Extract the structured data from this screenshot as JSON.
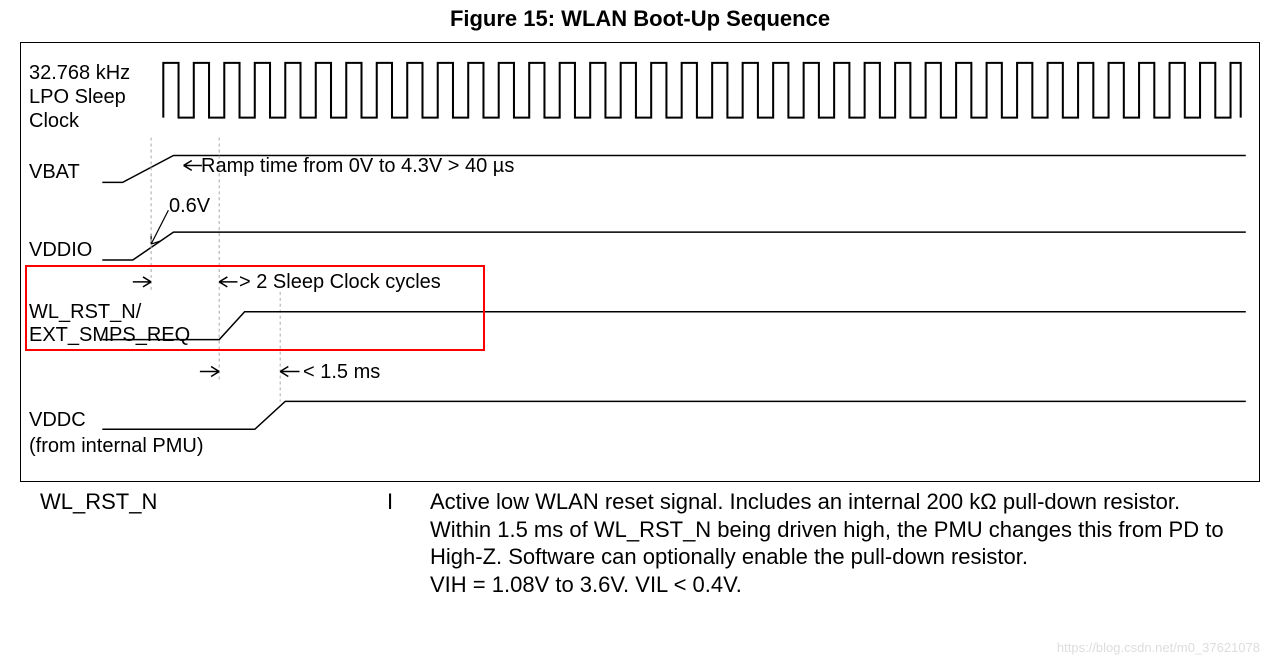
{
  "figure": {
    "title": "Figure 15:  WLAN Boot-Up Sequence",
    "signals": {
      "lpo": "32.768 kHz LPO Sleep Clock",
      "vbat": "VBAT",
      "vddio": "VDDIO",
      "wlrstn": "WL_RST_N/ EXT_SMPS_REQ",
      "vddc": "VDDC",
      "vddc_sub": "(from internal PMU)"
    },
    "annotations": {
      "ramp": "Ramp time from 0V to 4.3V > 40 µs",
      "v06": "0.6V",
      "sleep_cycles": "> 2 Sleep Clock cycles",
      "t15ms": "< 1.5 ms"
    }
  },
  "desc": {
    "name": "WL_RST_N",
    "io": "I",
    "text": "Active low WLAN reset signal. Includes an internal 200 kΩ pull-down resistor. Within 1.5 ms of WL_RST_N being driven high, the PMU changes this from PD to High-Z. Software can optionally enable the pull-down resistor.\nVIH = 1.08V to 3.6V. VIL < 0.4V."
  },
  "watermark": "https://blog.csdn.net/m0_37621078"
}
